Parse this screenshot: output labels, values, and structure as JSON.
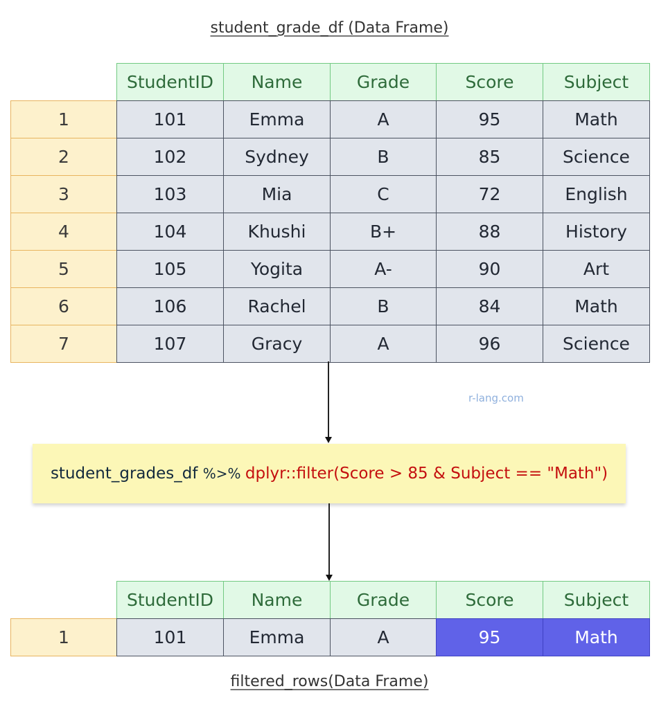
{
  "top_title": "student_grade_df (Data Frame)",
  "bottom_title": "filtered_rows(Data Frame)",
  "watermark": "r-lang.com",
  "columns": [
    "StudentID",
    "Name",
    "Grade",
    "Score",
    "Subject"
  ],
  "source_table": {
    "rows": [
      {
        "index": "1",
        "cells": [
          "101",
          "Emma",
          "A",
          "95",
          "Math"
        ]
      },
      {
        "index": "2",
        "cells": [
          "102",
          "Sydney",
          "B",
          "85",
          "Science"
        ]
      },
      {
        "index": "3",
        "cells": [
          "103",
          "Mia",
          "C",
          "72",
          "English"
        ]
      },
      {
        "index": "4",
        "cells": [
          "104",
          "Khushi",
          "B+",
          "88",
          "History"
        ]
      },
      {
        "index": "5",
        "cells": [
          "105",
          "Yogita",
          "A-",
          "90",
          "Art"
        ]
      },
      {
        "index": "6",
        "cells": [
          "106",
          "Rachel",
          "B",
          "84",
          "Math"
        ]
      },
      {
        "index": "7",
        "cells": [
          "107",
          "Gracy",
          "A",
          "96",
          "Science"
        ]
      }
    ]
  },
  "code": {
    "object": "student_grades_df ",
    "pipe": "%>% ",
    "call": "dplyr::filter(Score > 85 & Subject == \"Math\")"
  },
  "result_table": {
    "highlighted_columns": [
      "Score",
      "Subject"
    ],
    "rows": [
      {
        "index": "1",
        "cells": [
          "101",
          "Emma",
          "A",
          "95",
          "Math"
        ]
      }
    ]
  },
  "colors": {
    "header_bg": "#e1f9e6",
    "index_bg": "#fdf1cc",
    "cell_bg": "#e1e5ec",
    "highlight_bg": "#6062e8",
    "code_bg": "#fcf7b7",
    "code_accent": "#c40f0f"
  }
}
